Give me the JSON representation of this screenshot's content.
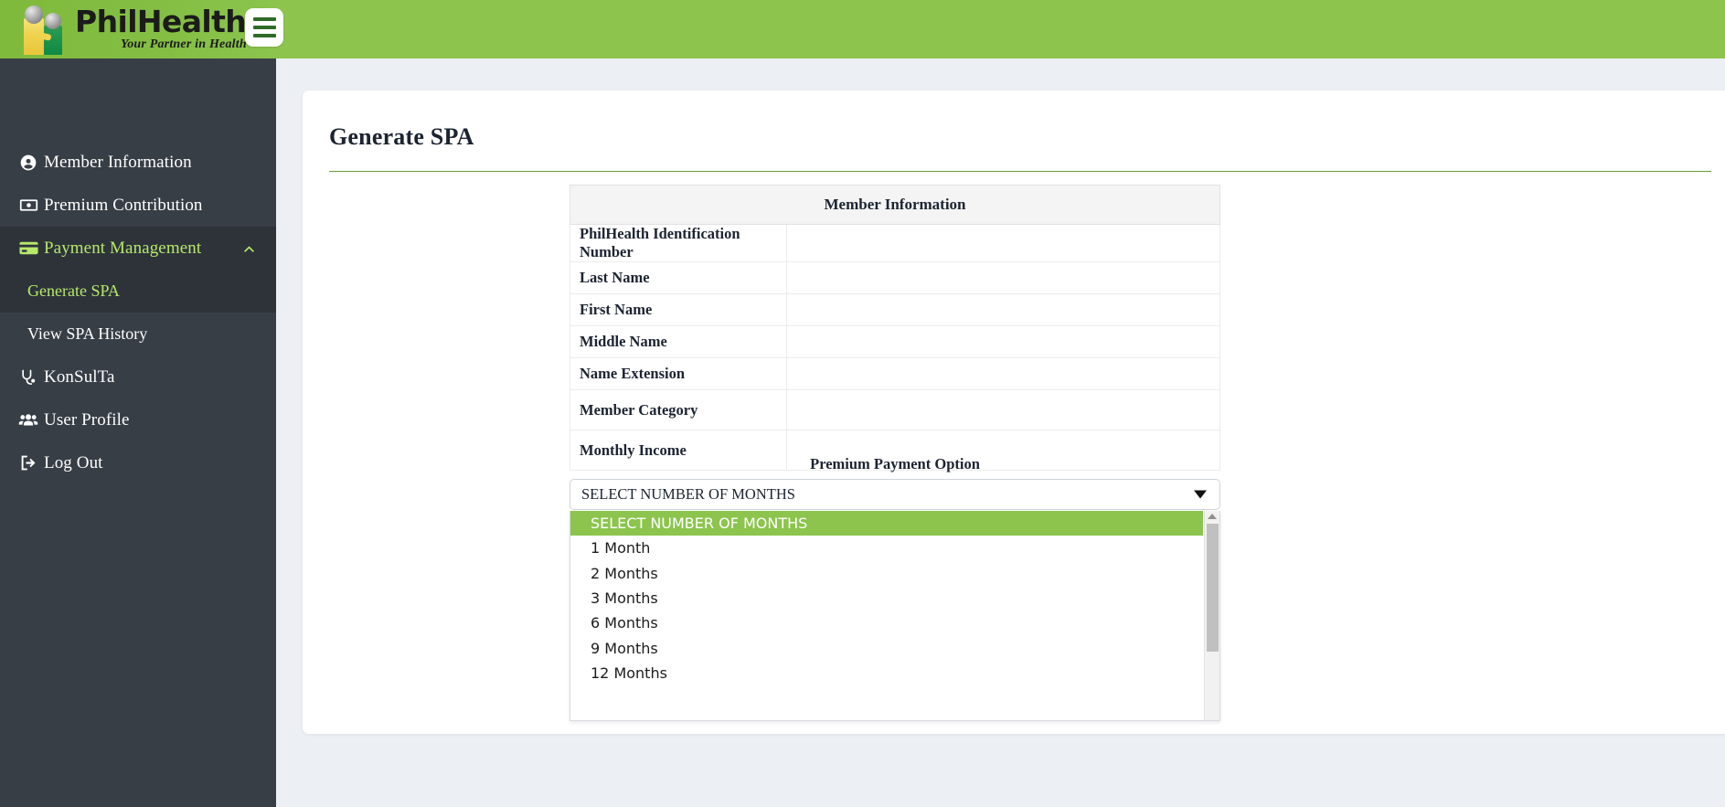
{
  "header": {
    "logo_title": "PhilHealth",
    "logo_tagline": "Your Partner in Health",
    "menu_toggle_label": "",
    "bg_color": "#8cc44d"
  },
  "sidebar": {
    "bg_color": "#383e46",
    "active_color": "#b6e86a",
    "items": [
      {
        "label": "Member Information",
        "icon": "user-circle-icon",
        "active": false
      },
      {
        "label": "Premium Contribution",
        "icon": "money-bill-icon",
        "active": false
      },
      {
        "label": "Payment Management",
        "icon": "credit-card-icon",
        "active": true,
        "expanded": true
      },
      {
        "label": "KonSulTa",
        "icon": "stethoscope-icon",
        "active": false
      },
      {
        "label": "User Profile",
        "icon": "users-icon",
        "active": false
      },
      {
        "label": "Log Out",
        "icon": "sign-out-icon",
        "active": false
      }
    ],
    "submenu": [
      {
        "label": "Generate SPA",
        "active": true
      },
      {
        "label": "View SPA History",
        "active": false
      }
    ]
  },
  "main": {
    "page_title": "Generate SPA",
    "rule_color": "#6d9b3a"
  },
  "member_table": {
    "header": "Member Information",
    "rows": [
      {
        "label": "PhilHealth Identification Number",
        "value": ""
      },
      {
        "label": "Last Name",
        "value": ""
      },
      {
        "label": "First Name",
        "value": ""
      },
      {
        "label": "Middle Name",
        "value": ""
      },
      {
        "label": "Name Extension",
        "value": ""
      },
      {
        "label": "Member Category",
        "value": ""
      },
      {
        "label": "Monthly Income",
        "value": ""
      }
    ]
  },
  "premium_payment": {
    "label": "Premium Payment Option",
    "selected": "SELECT NUMBER OF MONTHS",
    "options": [
      "SELECT NUMBER OF MONTHS",
      "1 Month",
      "2 Months",
      "3 Months",
      "6 Months",
      "9 Months",
      "12 Months"
    ],
    "highlight_color": "#8cc44d",
    "dropdown_open": true
  }
}
